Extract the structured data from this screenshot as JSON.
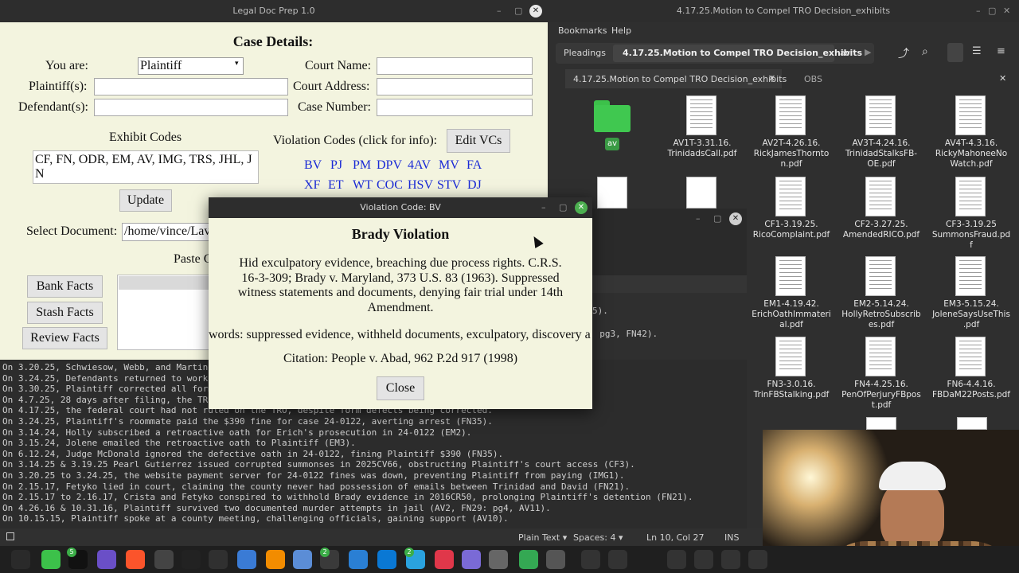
{
  "ldp": {
    "title": "Legal Doc Prep 1.0",
    "heading": "Case Details:",
    "you_are_label": "You are:",
    "you_are_value": "Plaintiff",
    "plaintiffs_label": "Plaintiff(s):",
    "defendants_label": "Defendant(s):",
    "court_name_label": "Court Name:",
    "court_address_label": "Court Address:",
    "case_number_label": "Case Number:",
    "exhibit_codes_label": "Exhibit Codes",
    "exhibit_codes_value": "CF, FN, ODR, EM, AV, IMG, TRS, JHL, J N",
    "update_label": "Update",
    "violation_codes_label": "Violation Codes (click for info):",
    "edit_vcs_label": "Edit VCs",
    "vc_row1": [
      "BV",
      "PJ",
      "PM",
      "DPV",
      "4AV",
      "MV",
      "FA"
    ],
    "vc_row2": [
      "XF",
      "ET",
      "WT",
      "COC",
      "HSV",
      "STV",
      "DJ"
    ],
    "select_document_label": "Select Document:",
    "select_document_value": "/home/vince/Lav",
    "paste_label": "Paste C",
    "bank_facts_label": "Bank Facts",
    "stash_facts_label": "Stash Facts",
    "review_facts_label": "Review Facts"
  },
  "dialog": {
    "title": "Violation Code: BV",
    "heading": "Brady Violation",
    "description": "Hid exculpatory evidence, breaching due process rights. C.R.S. 16-3-309; Brady v. Maryland, 373 U.S. 83 (1963). Suppressed witness statements and documents, denying fair trial under 14th Amendment.",
    "keywords": "words: suppressed evidence, withheld documents, exculpatory, discovery a",
    "citation": "Citation: People v. Abad, 962 P.2d 917 (1998)",
    "close_label": "Close"
  },
  "filemanager": {
    "title": "4.17.25.Motion to Compel TRO Decision_exhibits",
    "menu": [
      "Bookmarks",
      "Help"
    ],
    "path": [
      "Pleadings",
      "4.17.25.Motion to Compel TRO Decision_exhibits",
      "av"
    ],
    "tab_active": "4.17.25.Motion to Compel TRO Decision_exhibits",
    "tab_other": "OBS",
    "folder_label": "av",
    "files": [
      "AV1T-3.31.16. TrinidadsCall.pdf",
      "AV2T-4.26.16. RickJamesThornton.pdf",
      "AV3T-4.24.16. TrinidadStalksFB-OE.pdf",
      "AV4T-4.3.16. RickyMahoneeNoWatch.pdf",
      "CF1-3.19.25. RicoComplaint.pdf",
      "CF2-3.27.25. AmendedRICO.pdf",
      "CF3-3.19.25 SummonsFraud.pdf",
      "EM1-4.19.42. ErichOathImmaterial.pdf",
      "EM2-5.14.24. HollyRetroSubscribes.pdf",
      "EM3-5.15.24. JoleneSaysUseThis.pdf",
      "FN3-3.0.16. TrinFBStalking.pdf",
      "FN4-4.25.16. PenOfPerjuryFBpost.pdf",
      "FN6-4.4.16. FBDaM22Posts.pdf"
    ]
  },
  "terminal": {
    "peek_right_1": "5).",
    "peek_right_2": ": pg3, FN42).",
    "lines": [
      "On 3.20.25, Schwiesow, Webb, and Martine",
      "On 3.24.25, Defendants returned to work,",
      "On 3.30.25, Plaintiff corrected all form",
      "On 4.7.25, 28 days after filing, the TRO",
      "On 4.17.25, the federal court had not ruled on the TRO, despite form defects being corrected.",
      "On 3.24.25, Plaintiff's roommate paid the $390 fine for case 24-0122, averting arrest (FN35).",
      "On 3.14.24, Holly subscribed a retroactive oath for Erich's prosecution in 24-0122 (EM2).",
      "On 3.15.24, Jolene emailed the retroactive oath to Plaintiff (EM3).",
      "On 6.12.24, Judge McDonald ignored the defective oath in 24-0122, fining Plaintiff $390 (FN35).",
      "On 3.14.25 & 3.19.25 Pearl Gutierrez issued corrupted summonses in 2025CV66, obstructing Plaintiff's court access (CF3).",
      "On 3.20.25 to 3.24.25, the website payment server for 24-0122 fines was down, preventing Plaintiff from paying (IMG1).",
      "On 2.15.17, Fetyko lied in court, claiming the county never had possession of emails between Trinidad and David (FN21).",
      "On 2.15.17 to 2.16.17, Crista and Fetyko conspired to withhold Brady evidence in 2016CR50, prolonging Plaintiff's detention (FN21).",
      "On 4.26.16 & 10.31.16, Plaintiff survived two documented murder attempts in jail (AV2, FN29: pg4, AV11).",
      "On 10.15.15, Plaintiff spoke at a county meeting, challenging officials, gaining support (AV10)."
    ]
  },
  "statusbar": {
    "plain_text": "Plain Text",
    "spaces": "Spaces: 4",
    "position": "Ln 10, Col 27",
    "mode": "INS"
  },
  "taskbar": {
    "badge1": "5",
    "badge2": "2",
    "badge3": "2"
  }
}
